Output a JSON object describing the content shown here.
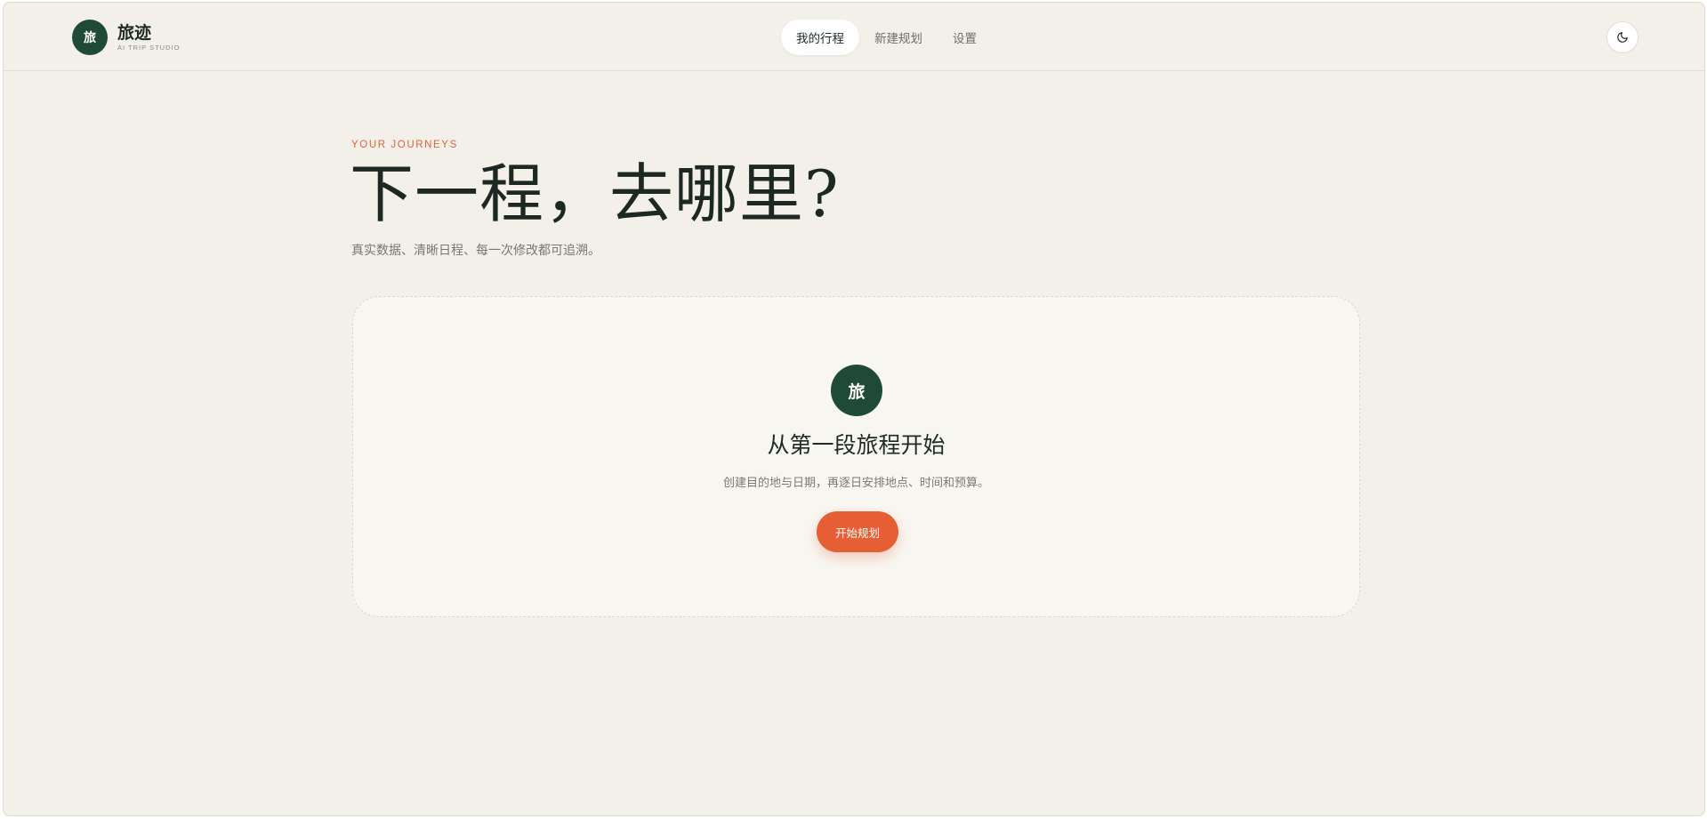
{
  "brand": {
    "mark": "旅",
    "name": "旅迹",
    "subtitle": "AI TRIP STUDIO"
  },
  "nav": {
    "items": [
      {
        "label": "我的行程",
        "active": true
      },
      {
        "label": "新建规划",
        "active": false
      },
      {
        "label": "设置",
        "active": false
      }
    ]
  },
  "theme_toggle": {
    "icon": "moon-icon"
  },
  "hero": {
    "eyebrow": "YOUR JOURNEYS",
    "title": "下一程，去哪里?",
    "subtitle": "真实数据、清晰日程、每一次修改都可追溯。"
  },
  "empty_state": {
    "mark": "旅",
    "title": "从第一段旅程开始",
    "description": "创建目的地与日期，再逐日安排地点、时间和预算。",
    "cta_label": "开始规划"
  },
  "colors": {
    "background": "#f3f0e9",
    "brand_green": "#1f4a38",
    "accent_orange": "#e65f34"
  }
}
